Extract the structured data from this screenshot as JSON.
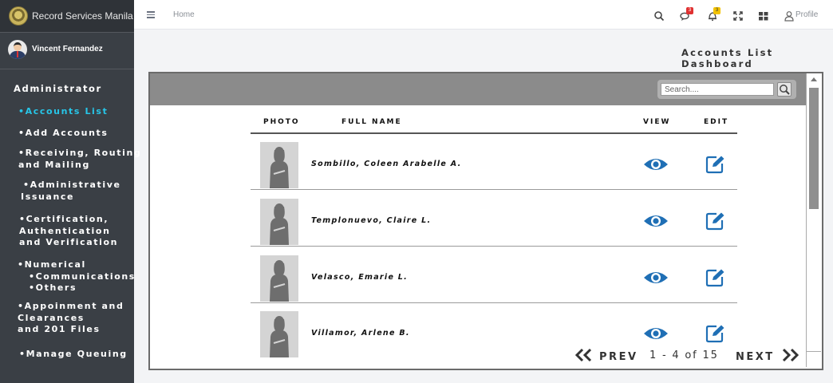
{
  "brand": {
    "name": "Record Services Manila"
  },
  "user": {
    "name": "Vincent Fernandez"
  },
  "sidebar": {
    "role": "Administrator",
    "items": [
      {
        "line1": "•Accounts List",
        "active": true
      },
      {
        "line1": "•Add Accounts"
      },
      {
        "line1": "•Receiving, Routing",
        "line2": "and Mailing"
      },
      {
        "line1": "•Administrative",
        "line2": "Issuance"
      },
      {
        "line1": "•Certification,",
        "line2": "Authentication",
        "line3": "and Verification"
      },
      {
        "line1": "•Numerical",
        "line2": "•Communications",
        "line3": "•Others"
      },
      {
        "line1": "•Appoinment and",
        "line2": "Clearances",
        "line3": "and 201 Files"
      },
      {
        "line1": "•Manage Queuing"
      }
    ]
  },
  "topbar": {
    "breadcrumb": "Home",
    "messages_badge": "3",
    "notifications_badge": "3",
    "profile_label": "Profile",
    "icons": [
      "search-icon",
      "messages-icon",
      "bell-icon",
      "fullscreen-icon",
      "apps-grid-icon",
      "user-icon"
    ]
  },
  "page": {
    "title": "Accounts List Dashboard"
  },
  "search": {
    "placeholder": "Search....",
    "value": ""
  },
  "table": {
    "columns": [
      "PHOTO",
      "FULL NAME",
      "VIEW",
      "EDIT"
    ],
    "rows": [
      {
        "full_name": "Sombillo, Coleen Arabelle A."
      },
      {
        "full_name": "Templonuevo, Claire L."
      },
      {
        "full_name": "Velasco, Emarie L."
      },
      {
        "full_name": "Villamor, Arlene B."
      }
    ]
  },
  "pagination": {
    "prev_label": "PREV",
    "info": "1 - 4 of 15",
    "next_label": "NEXT"
  },
  "colors": {
    "accent": "#27c6e8",
    "icon_blue": "#1f6fb5",
    "sidebar_bg": "#3a3f45",
    "header_bar": "#8b8b8b"
  }
}
